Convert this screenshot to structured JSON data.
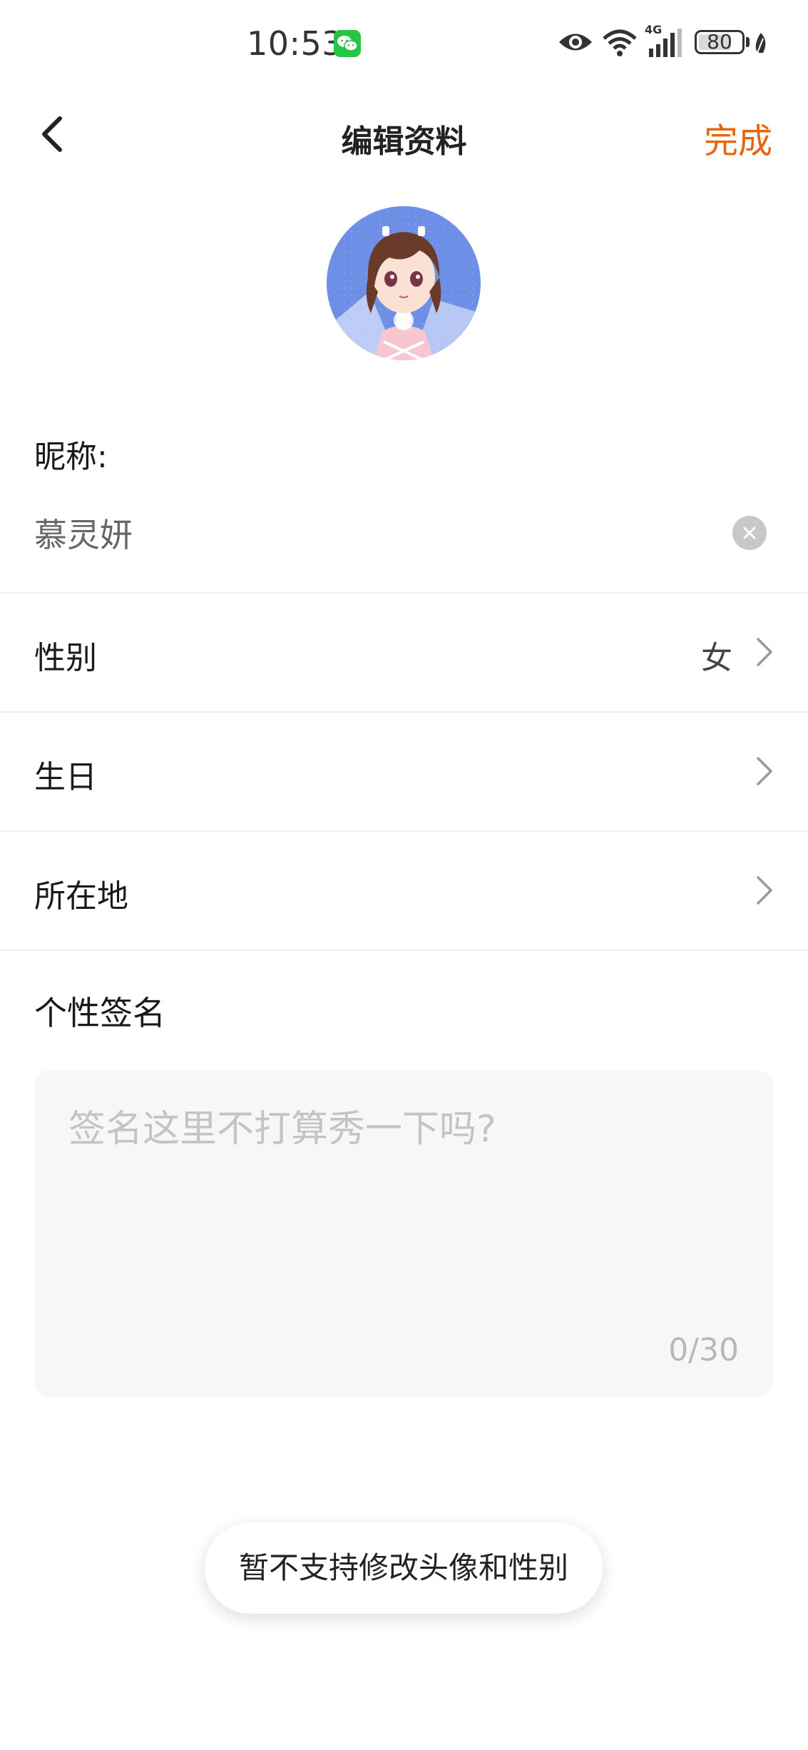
{
  "status_bar": {
    "time": "10:53",
    "network": "4G",
    "battery": "80",
    "battery_level": 0.8
  },
  "nav": {
    "title": "编辑资料",
    "done_label": "完成"
  },
  "nickname": {
    "label": "昵称:",
    "value": "慕灵妍"
  },
  "rows": [
    {
      "label": "性别",
      "value": "女"
    },
    {
      "label": "生日",
      "value": ""
    },
    {
      "label": "所在地",
      "value": ""
    }
  ],
  "signature": {
    "label": "个性签名",
    "placeholder": "签名这里不打算秀一下吗?",
    "counter": "0/30"
  },
  "toast": {
    "text": "暂不支持修改头像和性别"
  },
  "colors": {
    "accent": "#e8650d",
    "divider": "#eeeeee",
    "input_bg": "#f7f7f7"
  }
}
